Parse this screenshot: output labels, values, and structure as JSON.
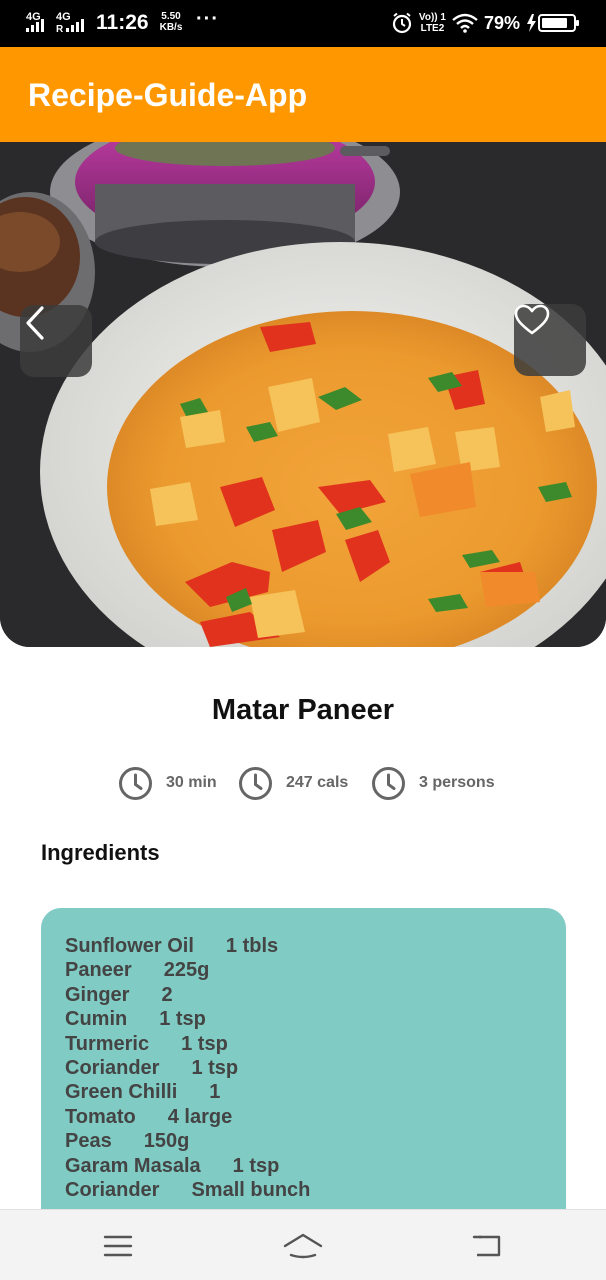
{
  "status_bar": {
    "network_1": "4G",
    "network_2": "4G",
    "time": "11:26",
    "speed_value": "5.50",
    "speed_unit": "KB/s",
    "more": "···",
    "lte_top": "Vo)) 1",
    "lte_bottom": "LTE2",
    "battery": "79%"
  },
  "app_bar": {
    "title": "Recipe-Guide-App"
  },
  "recipe": {
    "name": "Matar Paneer",
    "info": [
      {
        "icon": "clock-icon",
        "text": "30 min"
      },
      {
        "icon": "clock-icon",
        "text": "247 cals"
      },
      {
        "icon": "clock-icon",
        "text": "3 persons"
      }
    ],
    "ingredients_heading": "Ingredients",
    "ingredients": [
      {
        "name": "Sunflower Oil",
        "qty": "1 tbls"
      },
      {
        "name": "Paneer",
        "qty": "225g"
      },
      {
        "name": "Ginger",
        "qty": "2"
      },
      {
        "name": "Cumin",
        "qty": "1 tsp"
      },
      {
        "name": "Turmeric",
        "qty": "1 tsp"
      },
      {
        "name": "Coriander",
        "qty": "1 tsp"
      },
      {
        "name": "Green Chilli",
        "qty": "1"
      },
      {
        "name": "Tomato",
        "qty": "4 large"
      },
      {
        "name": "Peas",
        "qty": "150g"
      },
      {
        "name": "Garam Masala",
        "qty": "1 tsp"
      },
      {
        "name": "Coriander",
        "qty": "Small bunch"
      }
    ]
  },
  "colors": {
    "app_bar": "#FF9800",
    "card": "#80CBC4",
    "nav_bar": "#f3f3f3"
  },
  "nav": {
    "menu_icon": "menu-icon",
    "home_icon": "home-icon",
    "back_icon": "back-nav-icon"
  }
}
